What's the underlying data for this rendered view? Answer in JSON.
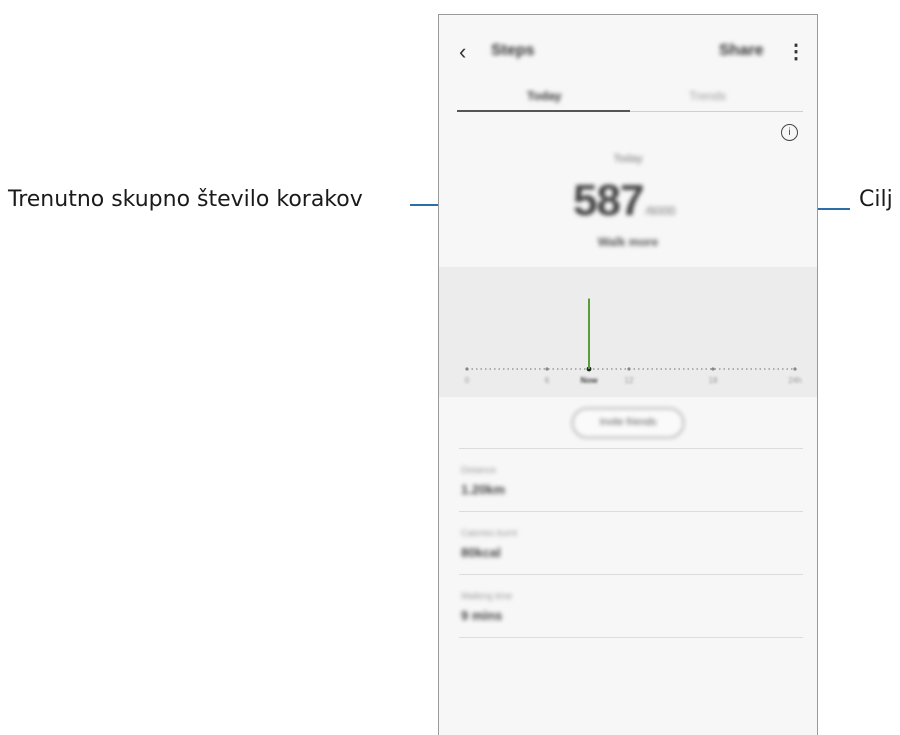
{
  "callouts": {
    "left": "Trenutno skupno število korakov",
    "right": "Cilj"
  },
  "app": {
    "title": "Steps",
    "share_label": "Share",
    "back_icon": "back-arrow-icon",
    "more_icon": "more-vertical-icon"
  },
  "tabs": [
    {
      "label": "Today",
      "selected": true
    },
    {
      "label": "Trends",
      "selected": false
    }
  ],
  "summary": {
    "period_label": "Today",
    "steps": "587",
    "goal": "/6000",
    "subtitle": "Walk more"
  },
  "chart_data": {
    "type": "bar",
    "x_ticks": [
      "0",
      "6",
      "Now",
      "12",
      "18",
      "24h"
    ],
    "highlight_tick": "Now",
    "values": [
      {
        "x": "Now",
        "value": 587
      }
    ]
  },
  "action_button": "Invite friends",
  "stats": [
    {
      "label": "Distance",
      "value": "1.20km"
    },
    {
      "label": "Calories burnt",
      "value": "80kcal"
    },
    {
      "label": "Walking time",
      "value": "9 mins"
    }
  ],
  "colors": {
    "leader_line": "#2a6fa8",
    "bar": "#5a9c3a"
  }
}
